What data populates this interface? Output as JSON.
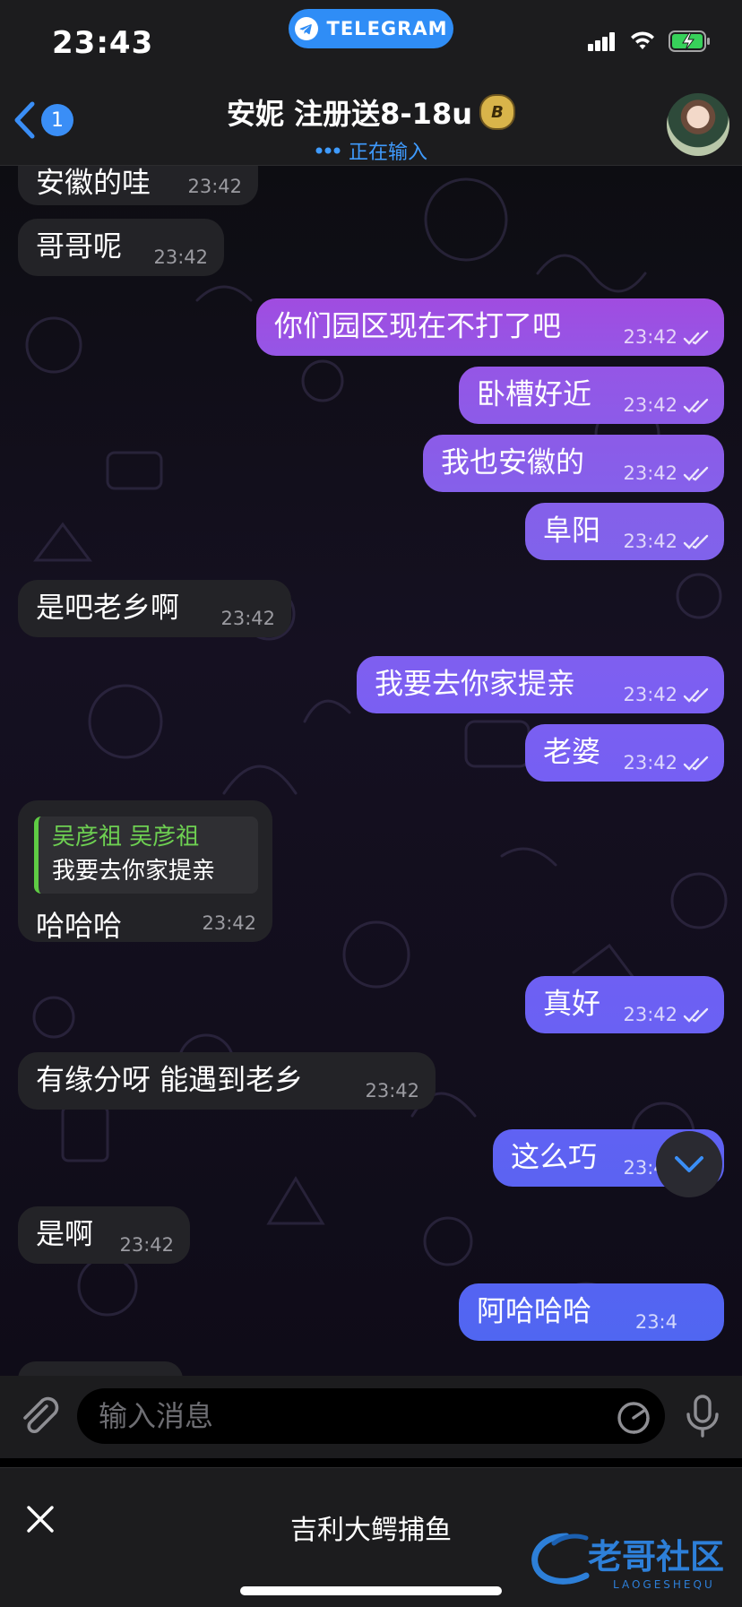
{
  "status_bar": {
    "time": "23:43",
    "app_pill_label": "TELEGRAM",
    "icons": [
      "signal-icon",
      "wifi-icon",
      "battery-charging-icon"
    ]
  },
  "header": {
    "back_badge": "1",
    "title": "安妮 注册送8-18u",
    "title_badge_letter": "B",
    "typing_status": "正在输入"
  },
  "messages": [
    {
      "dir": "in",
      "text": "安徽的哇",
      "time": "23:42"
    },
    {
      "dir": "in",
      "text": "哥哥呢",
      "time": "23:42"
    },
    {
      "dir": "out",
      "text": "你们园区现在不打了吧",
      "time": "23:42"
    },
    {
      "dir": "out",
      "text": "卧槽好近",
      "time": "23:42"
    },
    {
      "dir": "out",
      "text": "我也安徽的",
      "time": "23:42"
    },
    {
      "dir": "out",
      "text": "阜阳",
      "time": "23:42"
    },
    {
      "dir": "in",
      "text": "是吧老乡啊",
      "time": "23:42"
    },
    {
      "dir": "out",
      "text": "我要去你家提亲",
      "time": "23:42"
    },
    {
      "dir": "out",
      "text": "老婆",
      "time": "23:42"
    },
    {
      "dir": "in",
      "text": "哈哈哈",
      "time": "23:42",
      "reply": {
        "name": "吴彦祖 吴彦祖",
        "text": "我要去你家提亲"
      }
    },
    {
      "dir": "out",
      "text": "真好",
      "time": "23:42"
    },
    {
      "dir": "in",
      "text": "有缘分呀 能遇到老乡",
      "time": "23:42"
    },
    {
      "dir": "out",
      "text": "这么巧",
      "time": "23:42"
    },
    {
      "dir": "in",
      "text": "是啊",
      "time": "23:42"
    },
    {
      "dir": "out",
      "text": "阿哈哈哈",
      "time": "23:4"
    }
  ],
  "composer": {
    "placeholder": "输入消息"
  },
  "banner": {
    "text": "吉利大鳄捕鱼",
    "watermark_main": "老哥社区",
    "watermark_sub": "LAOGESHEQU"
  },
  "colors": {
    "outgoing_top": "#9b4fe0",
    "outgoing_bottom": "#4e5ef0",
    "incoming": "#232327",
    "accent": "#3a8ef6"
  }
}
